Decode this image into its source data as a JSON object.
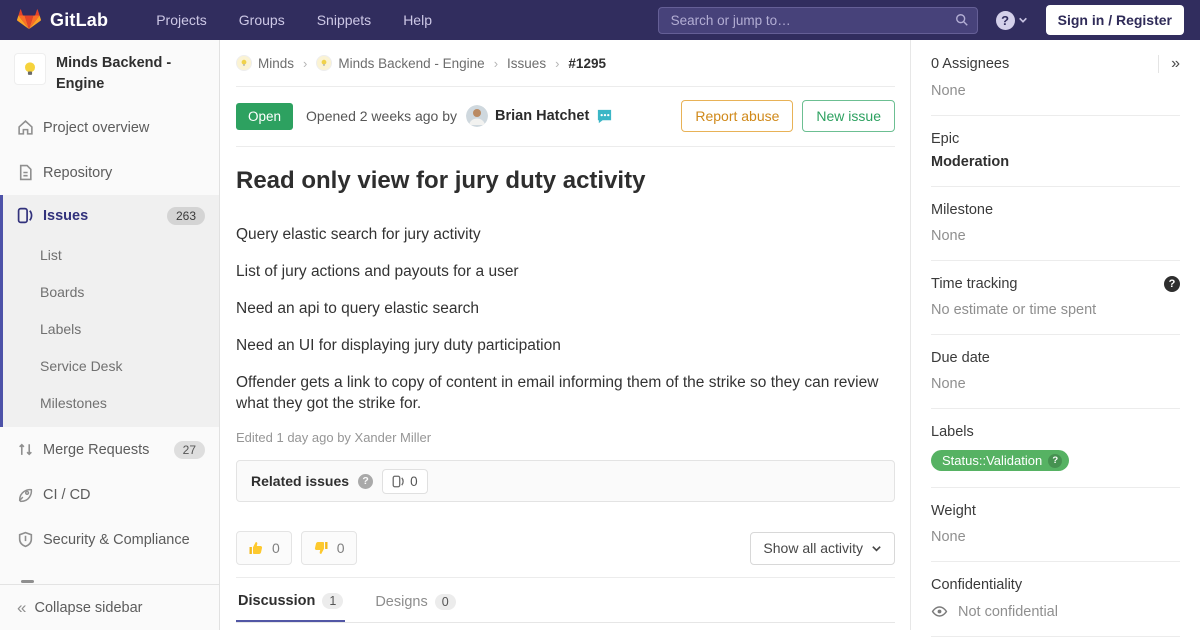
{
  "nav": {
    "brand": "GitLab",
    "links": [
      "Projects",
      "Groups",
      "Snippets",
      "Help"
    ],
    "search_placeholder": "Search or jump to…",
    "sign_in_label": "Sign in / Register"
  },
  "sidebar": {
    "project_name": "Minds Backend - Engine",
    "overview": "Project overview",
    "repository": "Repository",
    "issues": "Issues",
    "issues_badge": "263",
    "list": "List",
    "boards": "Boards",
    "labels": "Labels",
    "service_desk": "Service Desk",
    "milestones": "Milestones",
    "merge_requests": "Merge Requests",
    "mr_badge": "27",
    "cicd": "CI / CD",
    "security": "Security & Compliance",
    "collapse": "Collapse sidebar"
  },
  "breadcrumb": {
    "group": "Minds",
    "project": "Minds Backend - Engine",
    "section": "Issues",
    "current": "#1295"
  },
  "issue": {
    "status": "Open",
    "opened_text": "Opened 2 weeks ago by",
    "author": "Brian Hatchet",
    "report_abuse": "Report abuse",
    "new_issue": "New issue",
    "title": "Read only view for jury duty activity",
    "paragraphs": [
      "Query elastic search for jury activity",
      "List of jury actions and payouts for a user",
      "Need an api to query elastic search",
      "Need an UI for displaying jury duty participation",
      "Offender gets a link to copy of content in email informing them of the strike so they can review what they got the strike for."
    ],
    "edited": "Edited 1 day ago by Xander Miller"
  },
  "related": {
    "title": "Related issues",
    "count": "0"
  },
  "reactions": {
    "thumbs_up_count": "0",
    "thumbs_down_count": "0",
    "activity_filter": "Show all activity"
  },
  "tabs": {
    "discussion": "Discussion",
    "discussion_badge": "1",
    "designs": "Designs",
    "designs_badge": "0"
  },
  "aside": {
    "assignees_label": "0 Assignees",
    "assignees_value": "None",
    "epic_label": "Epic",
    "epic_value": "Moderation",
    "milestone_label": "Milestone",
    "milestone_value": "None",
    "time_label": "Time tracking",
    "time_value": "No estimate or time spent",
    "due_label": "Due date",
    "due_value": "None",
    "labels_label": "Labels",
    "label_pill": "Status::Validation",
    "weight_label": "Weight",
    "weight_value": "None",
    "conf_label": "Confidentiality",
    "conf_value": "Not confidential"
  },
  "colors": {
    "navbar": "#312d5e",
    "accent": "#4d52a8",
    "open_green": "#2da160",
    "label_green": "#56b263",
    "abuse_orange": "#d0891a"
  }
}
